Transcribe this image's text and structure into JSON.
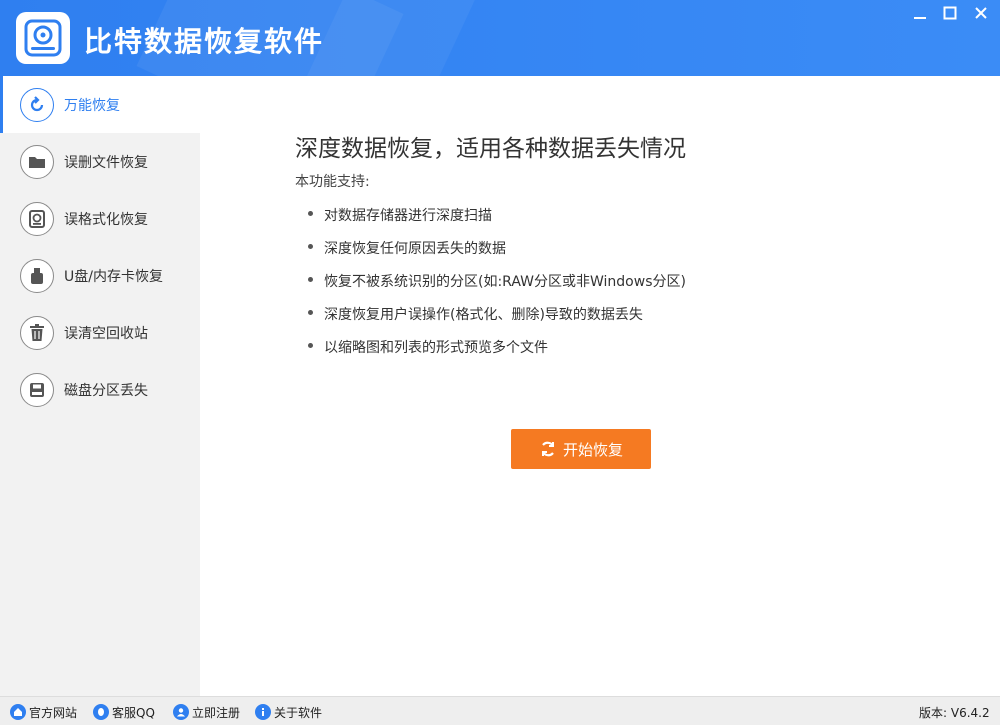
{
  "app": {
    "title": "比特数据恢复软件",
    "accent_color": "#2f7ff0",
    "button_color": "#f57a22"
  },
  "window_controls": {
    "minimize": "▁",
    "maximize": "□",
    "close": "✕"
  },
  "sidebar": {
    "items": [
      {
        "label": "万能恢复",
        "icon": "refresh-icon",
        "active": true
      },
      {
        "label": "误删文件恢复",
        "icon": "folder-icon",
        "active": false
      },
      {
        "label": "误格式化恢复",
        "icon": "format-disk-icon",
        "active": false
      },
      {
        "label": "U盘/内存卡恢复",
        "icon": "usb-icon",
        "active": false
      },
      {
        "label": "误清空回收站",
        "icon": "trash-icon",
        "active": false
      },
      {
        "label": "磁盘分区丢失",
        "icon": "disk-icon",
        "active": false
      }
    ]
  },
  "main": {
    "title": "深度数据恢复，适用各种数据丢失情况",
    "subtitle": "本功能支持:",
    "features": [
      "对数据存储器进行深度扫描",
      "深度恢复任何原因丢失的数据",
      "恢复不被系统识别的分区(如:RAW分区或非Windows分区)",
      "深度恢复用户误操作(格式化、删除)导致的数据丢失",
      "以缩略图和列表的形式预览多个文件"
    ],
    "start_button": "开始恢复"
  },
  "footer": {
    "links": [
      {
        "label": "官方网站",
        "icon": "home-icon"
      },
      {
        "label": "客服QQ",
        "icon": "qq-icon"
      },
      {
        "label": "立即注册",
        "icon": "user-icon"
      },
      {
        "label": "关于软件",
        "icon": "info-icon"
      }
    ],
    "version": "版本: V6.4.2"
  }
}
